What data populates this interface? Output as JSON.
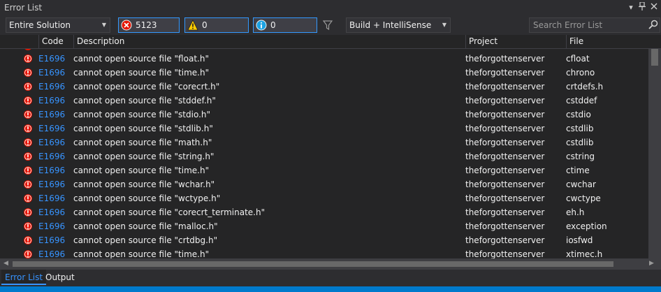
{
  "window": {
    "title": "Error List"
  },
  "toolbar": {
    "scope": "Entire Solution",
    "errors": "5123 Errors",
    "warnings": "0 Warnings",
    "messages": "0 Messages",
    "source": "Build + IntelliSense",
    "search_placeholder": "Search Error List"
  },
  "columns": {
    "code": "Code",
    "description": "Description",
    "project": "Project",
    "file": "File"
  },
  "rows": [
    {
      "code": "E1696",
      "description": "cannot open source file \"float.h\"",
      "project": "theforgottenserver",
      "file": "cfloat"
    },
    {
      "code": "E1696",
      "description": "cannot open source file \"time.h\"",
      "project": "theforgottenserver",
      "file": "chrono"
    },
    {
      "code": "E1696",
      "description": "cannot open source file \"corecrt.h\"",
      "project": "theforgottenserver",
      "file": "crtdefs.h"
    },
    {
      "code": "E1696",
      "description": "cannot open source file \"stddef.h\"",
      "project": "theforgottenserver",
      "file": "cstddef"
    },
    {
      "code": "E1696",
      "description": "cannot open source file \"stdio.h\"",
      "project": "theforgottenserver",
      "file": "cstdio"
    },
    {
      "code": "E1696",
      "description": "cannot open source file \"stdlib.h\"",
      "project": "theforgottenserver",
      "file": "cstdlib"
    },
    {
      "code": "E1696",
      "description": "cannot open source file \"math.h\"",
      "project": "theforgottenserver",
      "file": "cstdlib"
    },
    {
      "code": "E1696",
      "description": "cannot open source file \"string.h\"",
      "project": "theforgottenserver",
      "file": "cstring"
    },
    {
      "code": "E1696",
      "description": "cannot open source file \"time.h\"",
      "project": "theforgottenserver",
      "file": "ctime"
    },
    {
      "code": "E1696",
      "description": "cannot open source file \"wchar.h\"",
      "project": "theforgottenserver",
      "file": "cwchar"
    },
    {
      "code": "E1696",
      "description": "cannot open source file \"wctype.h\"",
      "project": "theforgottenserver",
      "file": "cwctype"
    },
    {
      "code": "E1696",
      "description": "cannot open source file \"corecrt_terminate.h\"",
      "project": "theforgottenserver",
      "file": "eh.h"
    },
    {
      "code": "E1696",
      "description": "cannot open source file \"malloc.h\"",
      "project": "theforgottenserver",
      "file": "exception"
    },
    {
      "code": "E1696",
      "description": "cannot open source file \"crtdbg.h\"",
      "project": "theforgottenserver",
      "file": "iosfwd"
    },
    {
      "code": "E1696",
      "description": "cannot open source file \"time.h\"",
      "project": "theforgottenserver",
      "file": "xtimec.h"
    }
  ],
  "tabs": {
    "error_list": "Error List",
    "output": "Output"
  },
  "icons": {
    "title_dropdown": "chevron-down-icon",
    "pin": "pin-icon",
    "close": "close-icon",
    "error": "error-circle-icon",
    "warning": "warning-triangle-icon",
    "info": "info-circle-icon",
    "filter": "filter-icon",
    "search": "search-icon",
    "row_error": "error-icon"
  },
  "colors": {
    "accent": "#007acc",
    "link": "#3794ff",
    "error": "#e51400",
    "warning": "#ffcc00",
    "info": "#1ba1e2"
  }
}
